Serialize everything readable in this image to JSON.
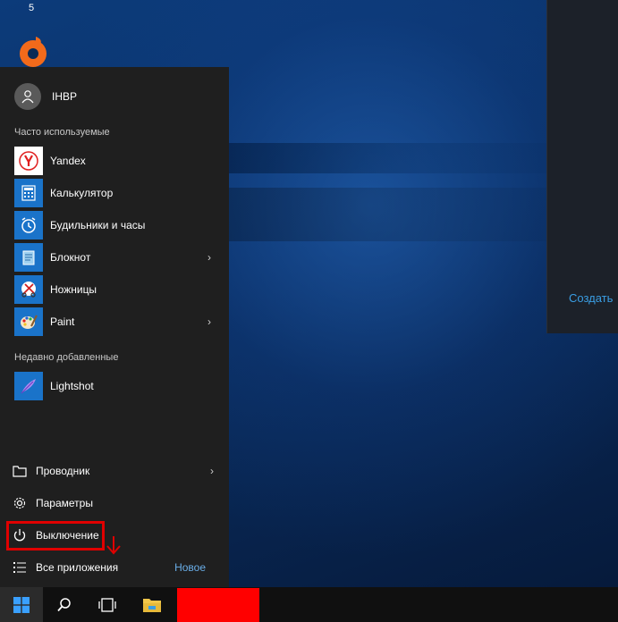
{
  "desktop": {
    "icon_number": "5",
    "right_panel_link": "Создать"
  },
  "start_menu": {
    "user_name": "IHBP",
    "most_used_label": "Часто используемые",
    "most_used": [
      {
        "label": "Yandex",
        "icon": "yandex-icon",
        "has_arrow": false
      },
      {
        "label": "Калькулятор",
        "icon": "calculator-icon",
        "has_arrow": false
      },
      {
        "label": "Будильники и часы",
        "icon": "alarm-clock-icon",
        "has_arrow": false
      },
      {
        "label": "Блокнот",
        "icon": "notepad-icon",
        "has_arrow": true
      },
      {
        "label": "Ножницы",
        "icon": "snipping-tool-icon",
        "has_arrow": false
      },
      {
        "label": "Paint",
        "icon": "paint-icon",
        "has_arrow": true
      }
    ],
    "recently_added_label": "Недавно добавленные",
    "recently_added": [
      {
        "label": "Lightshot",
        "icon": "lightshot-feather-icon"
      }
    ],
    "bottom": {
      "explorer": "Проводник",
      "settings": "Параметры",
      "power": "Выключение",
      "all_apps": "Все приложения",
      "new_badge": "Новое"
    },
    "chevron": "›"
  },
  "taskbar": {
    "buttons": [
      "windows-logo-icon",
      "search-icon",
      "task-view-icon",
      "file-explorer-icon"
    ]
  },
  "colors": {
    "accent": "#1a73c9",
    "highlight": "#e00000",
    "menu_bg": "#1f1f1f"
  }
}
